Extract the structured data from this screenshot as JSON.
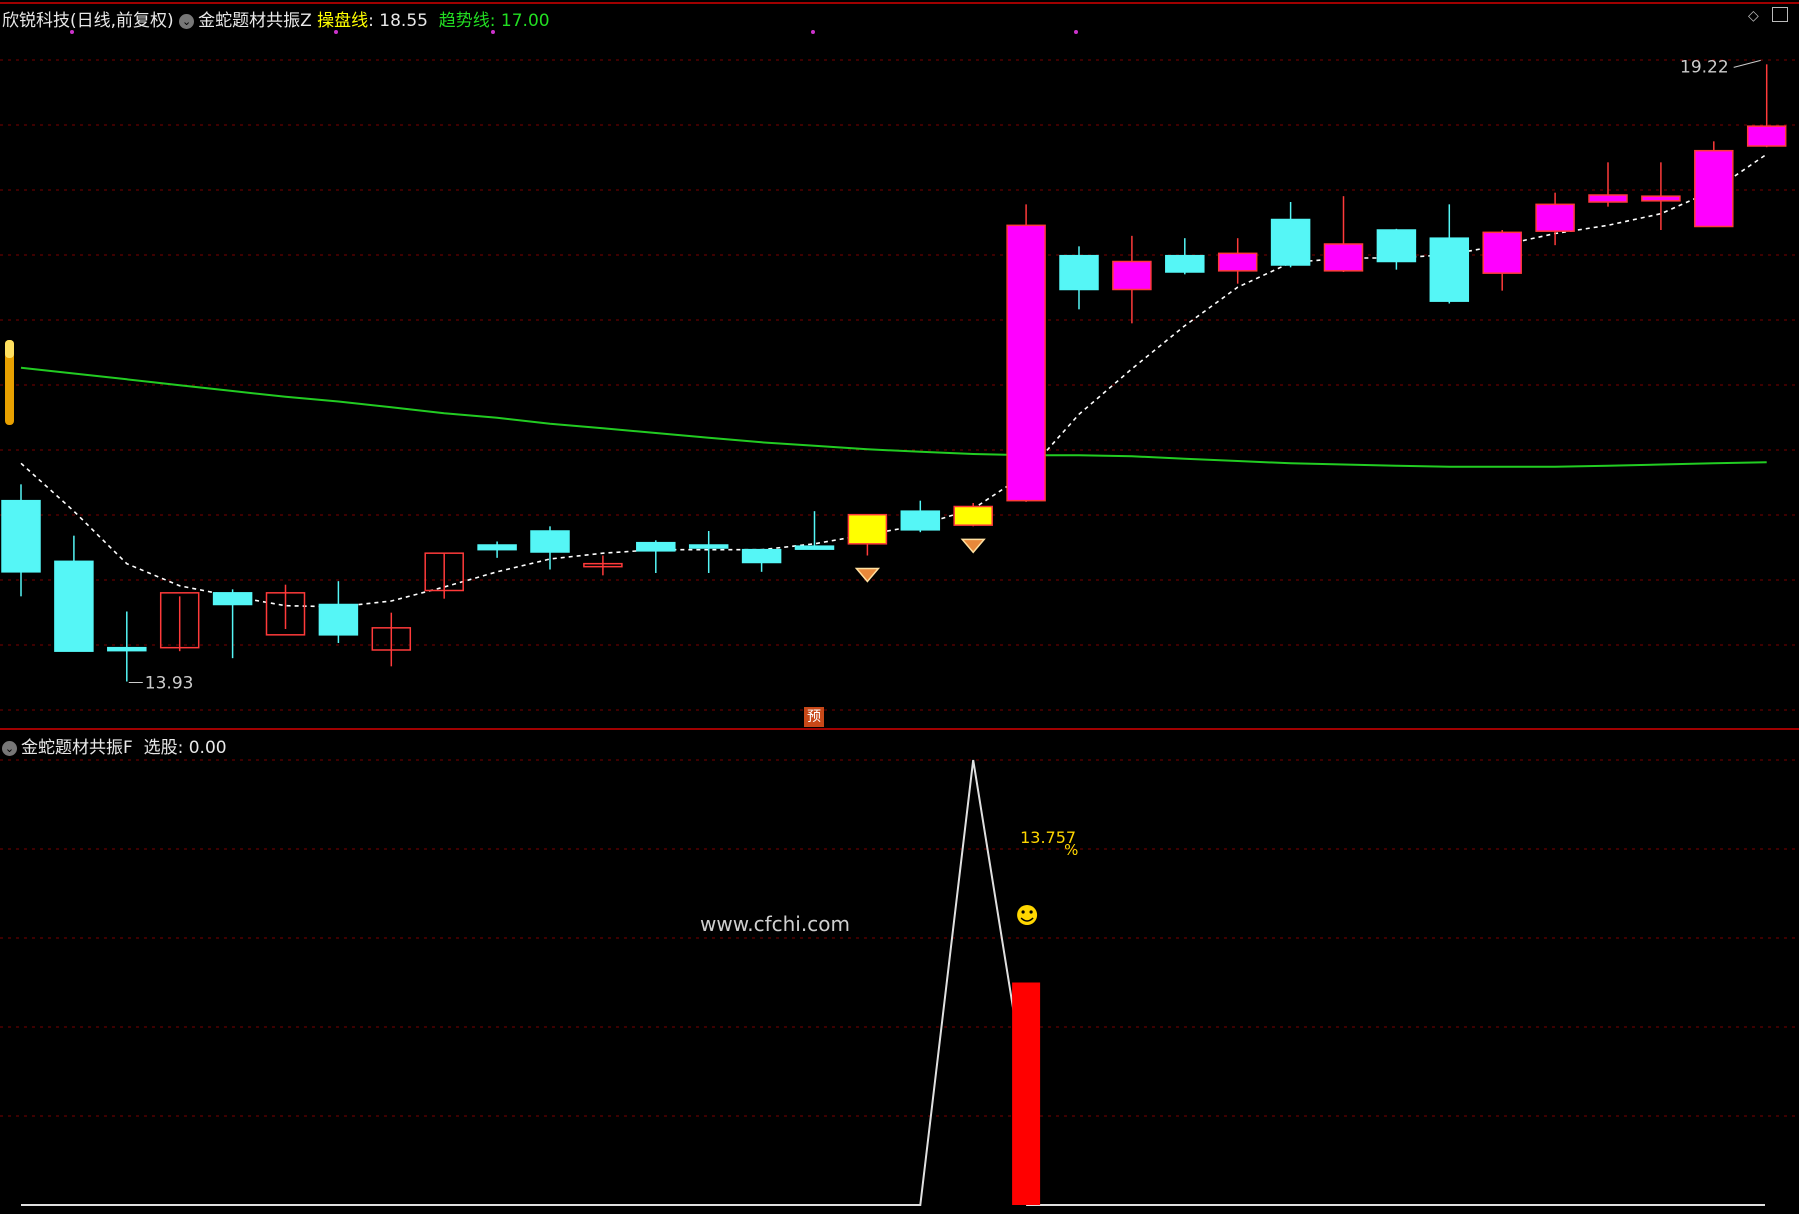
{
  "main_header": {
    "stock": "欣锐科技(日线,前复权)",
    "indicator": "金蛇题材共振Z",
    "line1_label": "操盘线",
    "line1_value": "18.55",
    "line2_label": "趋势线",
    "line2_value": "17.00"
  },
  "sub_header": {
    "indicator": "金蛇题材共振F",
    "value_label": "选股",
    "value": "0.00"
  },
  "watermark": "www.cfchi.com",
  "pre_marker": "预",
  "colors": {
    "background": "#000000",
    "up_candle": "#ff3a3a",
    "down_candle": "#55f6f6",
    "strong_candle": "#ff00ff",
    "signal_candle": "#ffff00",
    "trend_line": "#22cc22",
    "control_line": "#ffffff",
    "grid": "#7a0000",
    "signal_bar": "#ff0000"
  },
  "chart_data": [
    {
      "type": "candlestick",
      "title": "欣锐科技(日线,前复权)",
      "ylim": [
        13.6,
        19.6
      ],
      "candles": [
        {
          "o": 15.48,
          "h": 15.62,
          "l": 14.66,
          "c": 14.87,
          "color": "cyan"
        },
        {
          "o": 14.96,
          "h": 15.18,
          "l": 14.19,
          "c": 14.19,
          "color": "cyan"
        },
        {
          "o": 14.22,
          "h": 14.53,
          "l": 13.93,
          "c": 14.22,
          "color": "cyan"
        },
        {
          "o": 14.22,
          "h": 14.66,
          "l": 14.19,
          "c": 14.69,
          "color": "red"
        },
        {
          "o": 14.69,
          "h": 14.72,
          "l": 14.13,
          "c": 14.59,
          "color": "cyan"
        },
        {
          "o": 14.33,
          "h": 14.76,
          "l": 14.38,
          "c": 14.69,
          "color": "red"
        },
        {
          "o": 14.59,
          "h": 14.79,
          "l": 14.26,
          "c": 14.33,
          "color": "cyan"
        },
        {
          "o": 14.2,
          "h": 14.52,
          "l": 14.06,
          "c": 14.39,
          "color": "red"
        },
        {
          "o": 14.71,
          "h": 15.03,
          "l": 14.64,
          "c": 15.03,
          "color": "red"
        },
        {
          "o": 15.06,
          "h": 15.13,
          "l": 14.99,
          "c": 15.1,
          "color": "cyan"
        },
        {
          "o": 15.22,
          "h": 15.26,
          "l": 14.89,
          "c": 15.04,
          "color": "cyan"
        },
        {
          "o": 14.92,
          "h": 15.01,
          "l": 14.84,
          "c": 14.94,
          "color": "red"
        },
        {
          "o": 15.12,
          "h": 15.14,
          "l": 14.86,
          "c": 15.05,
          "color": "cyan"
        },
        {
          "o": 15.1,
          "h": 15.22,
          "l": 14.86,
          "c": 15.08,
          "color": "cyan"
        },
        {
          "o": 15.06,
          "h": 15.05,
          "l": 14.87,
          "c": 14.95,
          "color": "cyan"
        },
        {
          "o": 15.09,
          "h": 15.39,
          "l": 15.06,
          "c": 15.09,
          "color": "cyan"
        },
        {
          "o": 15.11,
          "h": 15.36,
          "l": 15.01,
          "c": 15.36,
          "color": "yellow",
          "signal": true
        },
        {
          "o": 15.39,
          "h": 15.48,
          "l": 15.21,
          "c": 15.23,
          "color": "cyan"
        },
        {
          "o": 15.27,
          "h": 15.46,
          "l": 15.26,
          "c": 15.43,
          "color": "yellow",
          "signal": true
        },
        {
          "o": 15.48,
          "h": 18.02,
          "l": 15.47,
          "c": 17.84,
          "color": "magenta"
        },
        {
          "o": 17.58,
          "h": 17.66,
          "l": 17.12,
          "c": 17.29,
          "color": "cyan"
        },
        {
          "o": 17.29,
          "h": 17.75,
          "l": 17.0,
          "c": 17.53,
          "color": "magenta"
        },
        {
          "o": 17.58,
          "h": 17.73,
          "l": 17.42,
          "c": 17.44,
          "color": "cyan"
        },
        {
          "o": 17.45,
          "h": 17.73,
          "l": 17.34,
          "c": 17.6,
          "color": "magenta"
        },
        {
          "o": 17.89,
          "h": 18.04,
          "l": 17.48,
          "c": 17.5,
          "color": "cyan"
        },
        {
          "o": 17.45,
          "h": 18.09,
          "l": 17.44,
          "c": 17.68,
          "color": "magenta"
        },
        {
          "o": 17.8,
          "h": 17.81,
          "l": 17.46,
          "c": 17.53,
          "color": "cyan"
        },
        {
          "o": 17.73,
          "h": 18.02,
          "l": 17.17,
          "c": 17.19,
          "color": "cyan"
        },
        {
          "o": 17.43,
          "h": 17.8,
          "l": 17.28,
          "c": 17.78,
          "color": "magenta"
        },
        {
          "o": 17.79,
          "h": 18.12,
          "l": 17.67,
          "c": 18.02,
          "color": "magenta"
        },
        {
          "o": 18.04,
          "h": 18.38,
          "l": 18.0,
          "c": 18.1,
          "color": "magenta"
        },
        {
          "o": 18.05,
          "h": 18.38,
          "l": 17.8,
          "c": 18.09,
          "color": "magenta"
        },
        {
          "o": 17.83,
          "h": 18.56,
          "l": 17.87,
          "c": 18.48,
          "color": "magenta"
        },
        {
          "o": 18.52,
          "h": 19.22,
          "l": 18.51,
          "c": 18.69,
          "color": "magenta"
        }
      ],
      "series": [
        {
          "name": "操盘线",
          "style": "dashed-white",
          "values": [
            15.8,
            15.39,
            14.94,
            14.75,
            14.66,
            14.58,
            14.57,
            14.62,
            14.74,
            14.87,
            14.98,
            15.03,
            15.06,
            15.06,
            15.06,
            15.11,
            15.19,
            15.27,
            15.41,
            15.71,
            16.22,
            16.61,
            16.98,
            17.31,
            17.52,
            17.56,
            17.56,
            17.59,
            17.67,
            17.77,
            17.84,
            17.94,
            18.14,
            18.45
          ]
        },
        {
          "name": "趋势线",
          "style": "solid-green",
          "values": [
            16.62,
            16.57,
            16.52,
            16.47,
            16.42,
            16.37,
            16.33,
            16.28,
            16.23,
            16.19,
            16.14,
            16.1,
            16.06,
            16.02,
            15.98,
            15.95,
            15.92,
            15.9,
            15.88,
            15.87,
            15.87,
            15.86,
            15.84,
            15.82,
            15.8,
            15.79,
            15.78,
            15.77,
            15.77,
            15.77,
            15.78,
            15.79,
            15.8,
            15.81
          ]
        }
      ],
      "annotations": {
        "high_label": "19.22",
        "low_label": "13.93"
      }
    },
    {
      "type": "line",
      "title": "金蛇题材共振F",
      "ylim": [
        0,
        100
      ],
      "series": [
        {
          "name": "选股",
          "style": "white-line",
          "points": [
            [
              0,
              0
            ],
            [
              17,
              0
            ],
            [
              18,
              100
            ],
            [
              19,
              26
            ]
          ]
        }
      ],
      "bars": [
        {
          "index": 19,
          "value": 50
        }
      ],
      "label_value": "13.757",
      "label_suffix": "%"
    }
  ]
}
